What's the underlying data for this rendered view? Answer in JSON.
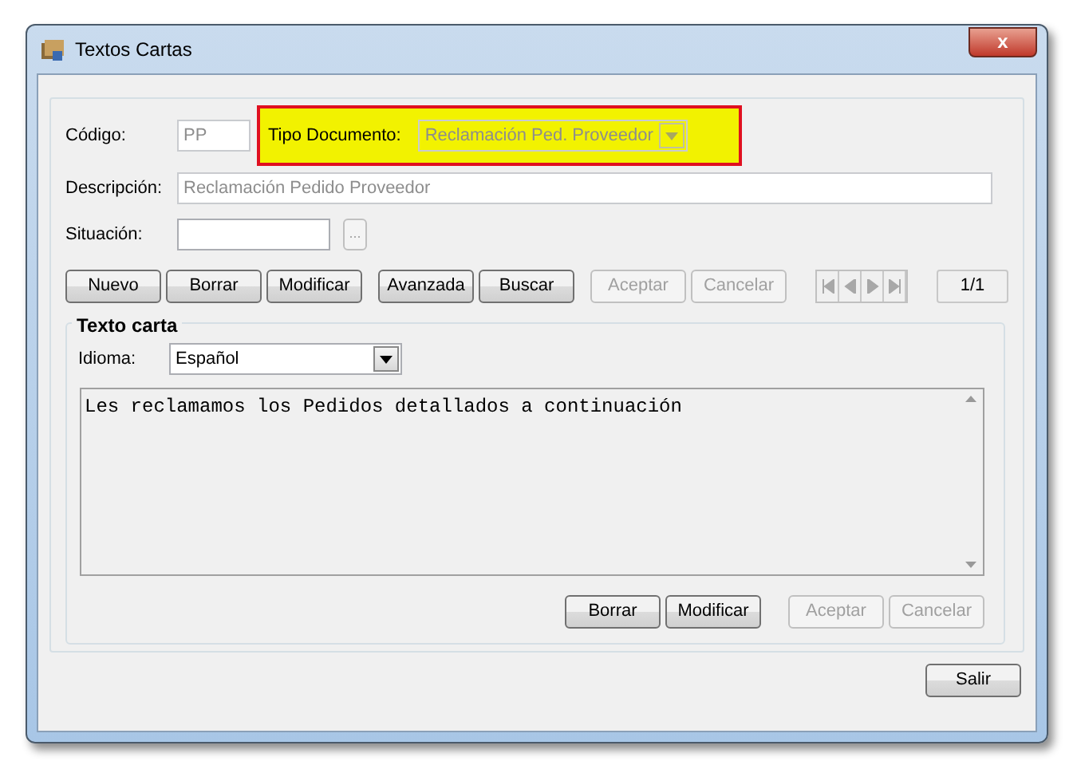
{
  "window": {
    "title": "Textos Cartas",
    "close_label": "x"
  },
  "fields": [
    {
      "label": "Código:",
      "value": "PP",
      "disabled": true
    },
    {
      "label": "Tipo Documento:",
      "value": "Reclamación Ped. Proveedor",
      "disabled": true,
      "highlighted": true
    },
    {
      "label": "Descripción:",
      "value": "Reclamación Pedido Proveedor",
      "disabled": true
    },
    {
      "label": "Situación:",
      "disabled": false
    }
  ],
  "lookup_button": {
    "label": "...",
    "disabled": true
  },
  "toolbar": [
    {
      "label": "Nuevo",
      "disabled": false
    },
    {
      "label": "Borrar",
      "disabled": false
    },
    {
      "label": "Modificar",
      "disabled": false
    },
    {
      "label": "Avanzada",
      "disabled": false
    },
    {
      "label": "Buscar",
      "disabled": false
    },
    {
      "label": "Aceptar",
      "disabled": true
    },
    {
      "label": "Cancelar",
      "disabled": true
    }
  ],
  "record_counter": "1/1",
  "letter_group": {
    "title": "Texto carta",
    "language_label": "Idioma:",
    "language": "Español",
    "text": "Les reclamamos los Pedidos detallados a continuación",
    "buttons": [
      {
        "label": "Borrar",
        "disabled": false
      },
      {
        "label": "Modificar",
        "disabled": false
      },
      {
        "label": "Aceptar",
        "disabled": true
      },
      {
        "label": "Cancelar",
        "disabled": true
      }
    ]
  },
  "exit_button": {
    "label": "Salir",
    "disabled": false
  }
}
